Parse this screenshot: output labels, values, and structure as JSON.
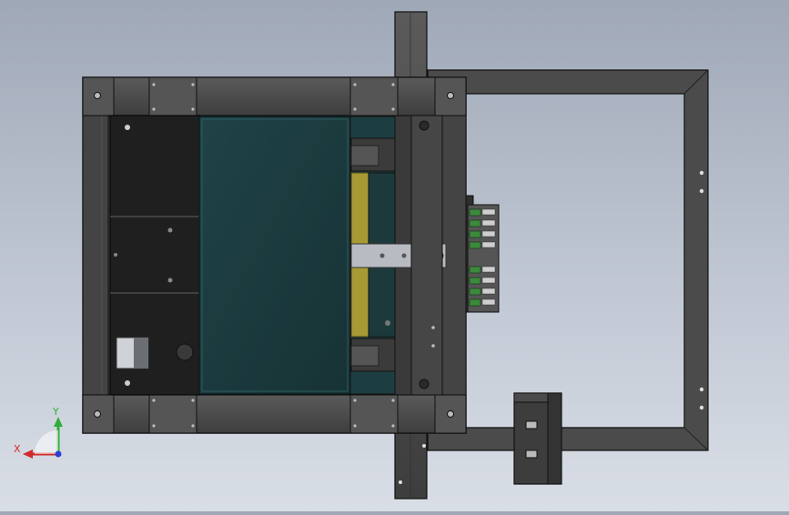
{
  "viewport": {
    "background_top": "#9fa8b7",
    "background_bottom": "#d9dee6"
  },
  "model": {
    "view": "top",
    "colors": {
      "frame": "#4b4b4b",
      "frame_dark": "#2f2f2f",
      "panel_black": "#1f1f1f",
      "panel_teal": "#1d3e41",
      "rail_yellow": "#a79a35",
      "slide_silver": "#b8bcc2",
      "connector_green": "#3c8a3c",
      "edge": "#111111"
    },
    "icons": [
      "bolt-icon",
      "connector-icon",
      "motor-icon"
    ]
  },
  "triad": {
    "x_label": "X",
    "y_label": "Y",
    "x_color": "#d22a2a",
    "y_color": "#2fae3a",
    "z_color": "#2a3fd2"
  }
}
